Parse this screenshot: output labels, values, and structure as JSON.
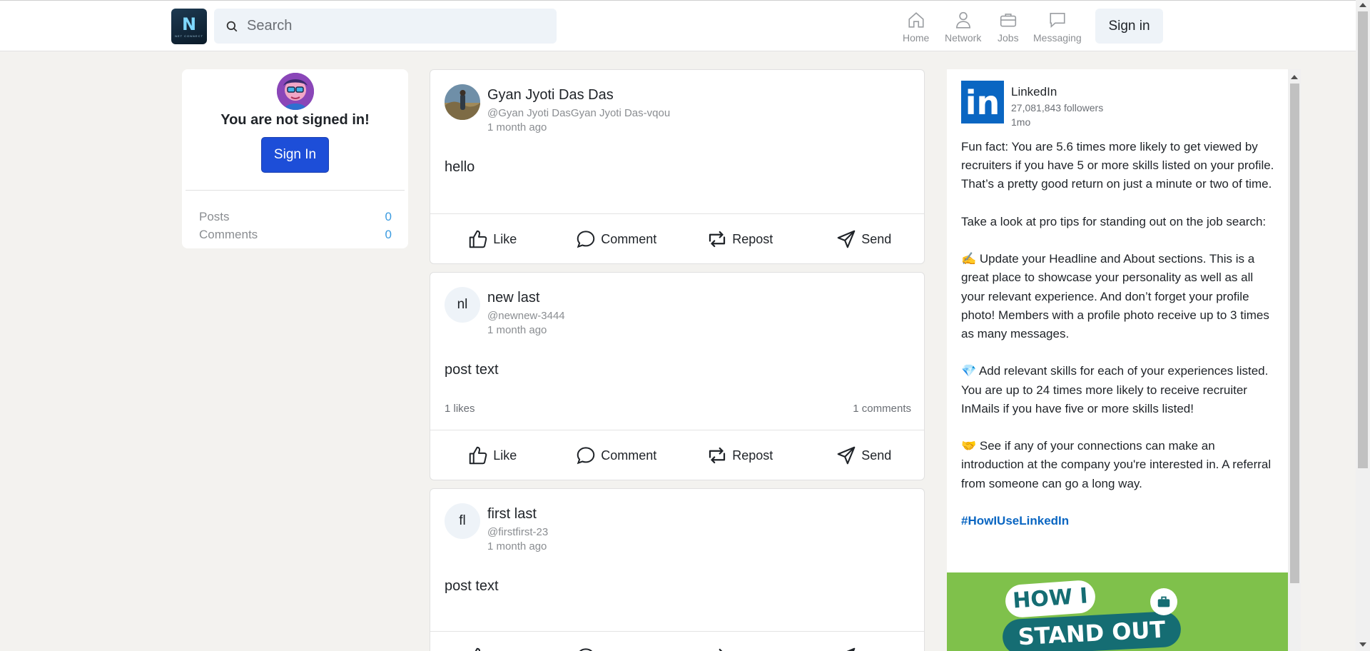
{
  "header": {
    "logo_letter": "N",
    "logo_subtitle": "NET CONNECT",
    "search_placeholder": "Search",
    "nav": [
      {
        "label": "Home",
        "icon": "home-icon"
      },
      {
        "label": "Network",
        "icon": "user-icon"
      },
      {
        "label": "Jobs",
        "icon": "briefcase-icon"
      },
      {
        "label": "Messaging",
        "icon": "message-icon"
      }
    ],
    "signin_label": "Sign in"
  },
  "sidebar": {
    "status_text": "You are not signed in!",
    "signin_button": "Sign In",
    "stats": [
      {
        "label": "Posts",
        "value": "0"
      },
      {
        "label": "Comments",
        "value": "0"
      }
    ]
  },
  "feed": {
    "actions": [
      "Like",
      "Comment",
      "Repost",
      "Send"
    ],
    "posts": [
      {
        "initials": "",
        "name": "Gyan Jyoti Das Das",
        "handle": "@Gyan Jyoti DasGyan Jyoti Das-vqou",
        "time": "1 month ago",
        "text": "hello",
        "likes": "",
        "comments": ""
      },
      {
        "initials": "nl",
        "name": "new last",
        "handle": "@newnew-3444",
        "time": "1 month ago",
        "text": "post text",
        "likes": "1 likes",
        "comments": "1 comments"
      },
      {
        "initials": "fl",
        "name": "first last",
        "handle": "@firstfirst-23",
        "time": "1 month ago",
        "text": "post text",
        "likes": "",
        "comments": ""
      }
    ]
  },
  "promo": {
    "company": "LinkedIn",
    "followers": "27,081,843 followers",
    "age": "1mo",
    "paragraphs": [
      "Fun fact: You are 5.6 times more likely to get viewed by recruiters if you have 5 or more skills listed on your profile. That’s a pretty good return on just a minute or two of time.",
      "Take a look at pro tips for standing out on the job search:",
      "✍️ Update your Headline and About sections. This is a great place to showcase your personality as well as all your relevant experience. And don’t forget your profile photo! Members with a profile photo receive up to 3 times as many messages.",
      "💎 Add relevant skills for each of your experiences listed. You are up to 24 times more likely to receive recruiter InMails if you have five or more skills listed!",
      "🤝 See if any of your connections can make an introduction at the company you're interested in. A referral from someone can go a long way."
    ],
    "hashtag": "#HowIUseLinkedIn",
    "image_line1": "HOW I",
    "image_line2": "STAND OUT"
  },
  "colors": {
    "primary_button": "#1d4ed8",
    "linkedin_blue": "#0a66c2",
    "promo_green": "#7fc14b",
    "page_bg": "#f3f2ef"
  }
}
